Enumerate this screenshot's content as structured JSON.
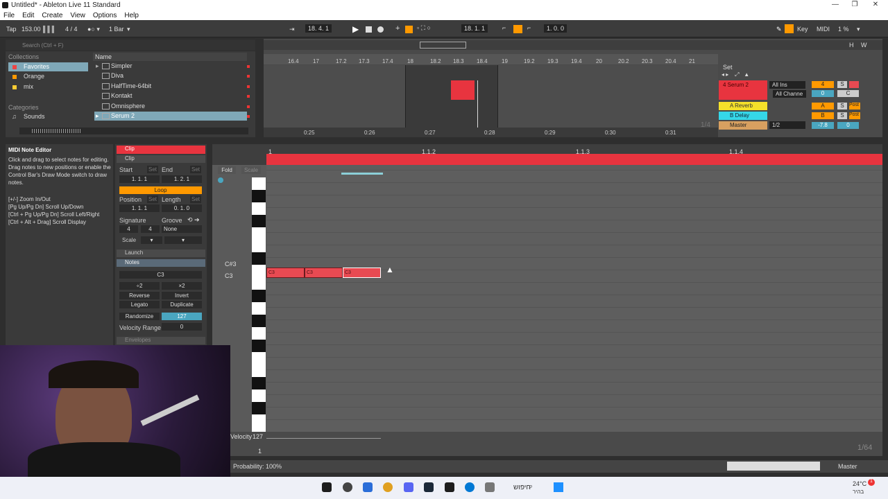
{
  "window": {
    "title": "Untitled* - Ableton Live 11 Standard",
    "buttons": [
      "—",
      "❐",
      "✕"
    ]
  },
  "menu": [
    "File",
    "Edit",
    "Create",
    "View",
    "Options",
    "Help"
  ],
  "transport": {
    "tap": "Tap",
    "tempo": "153.00",
    "signature": "4 / 4",
    "quantize": "1 Bar",
    "position": "18.   4.   1",
    "loop_start": "18.   1.   1",
    "loop_length": "1.   0.   0",
    "key": "Key",
    "midi": "MIDI",
    "cpu": "1 %"
  },
  "browser": {
    "search_placeholder": "Search (Ctrl + F)",
    "collections_header": "Collections",
    "collections": [
      {
        "label": "Favorites",
        "color": "#e44"
      },
      {
        "label": "Orange",
        "color": "#f90"
      },
      {
        "label": "mix",
        "color": "#fc3"
      }
    ],
    "categories_header": "Categories",
    "categories": [
      "Sounds"
    ],
    "name_header": "Name",
    "files": [
      "Simpler",
      "Diva",
      "HalfTime-64bit",
      "Kontakt",
      "Omnisphere",
      "Serum 2"
    ]
  },
  "arrangement": {
    "ruler": [
      "16.4",
      "17",
      "17.2",
      "17.3",
      "17.4",
      "18",
      "18.2",
      "18.3",
      "18.4",
      "19",
      "19.2",
      "19.3",
      "19.4",
      "20",
      "20.2",
      "20.3",
      "20.4",
      "21"
    ],
    "time": [
      "0:25",
      "0:26",
      "0:27",
      "0:28",
      "0:29",
      "0:30",
      "0:31"
    ],
    "set_label": "Set",
    "zoom": "1/4",
    "hw_h": "H",
    "hw_w": "W"
  },
  "mixer": {
    "tracks": [
      {
        "name": "4 Serum 2",
        "color": "#e8343f",
        "input": "All Ins",
        "channel": "All Channe",
        "num": "4",
        "vol": "0",
        "pan": "C"
      },
      {
        "name": "A Reverb",
        "color": "#f5e12a",
        "num": "A",
        "send": "Post"
      },
      {
        "name": "B Delay",
        "color": "#35d7e8",
        "num": "B",
        "send": "Post"
      },
      {
        "name": "Master",
        "color": "#d8a060",
        "split": "1/2",
        "vol": "-7.8",
        "pan": "0"
      }
    ]
  },
  "help": {
    "title": "MIDI Note Editor",
    "body": "Click and drag to select notes for editing. Drag notes to new positions or enable the Control Bar's Draw Mode switch to draw notes.",
    "shortcuts": [
      "[+/-] Zoom In/Out",
      "[Pg Up/Pg Dn] Scroll Up/Down",
      "[Ctrl + Pg Up/Pg Dn] Scroll Left/Right",
      "[Ctrl + Alt + Drag] Scroll Display"
    ]
  },
  "clip": {
    "name": "Clip",
    "section": "Clip",
    "start": "Start",
    "end": "End",
    "set": "Set",
    "start_val": "1.   1.   1",
    "end_val": "1.   2.   1",
    "loop": "Loop",
    "position": "Position",
    "length": "Length",
    "position_val": "1.   1.   1",
    "length_val": "0.   1.   0",
    "signature": "Signature",
    "groove": "Groove",
    "sig_num": "4",
    "sig_den": "4",
    "groove_val": "None",
    "scale": "Scale",
    "launch": "Launch",
    "notes": "Notes",
    "note_val": "C3",
    "half": "÷2",
    "double": "×2",
    "reverse": "Reverse",
    "invert": "Invert",
    "legato": "Legato",
    "duplicate": "Duplicate",
    "randomize": "Randomize",
    "rand_val": "127",
    "vel_range": "Velocity Range",
    "vel_range_val": "0",
    "envelopes": "Envelopes"
  },
  "editor": {
    "fold": "Fold",
    "scale": "Scale",
    "bar_labels": [
      "1",
      "1.1.2",
      "1.1.3",
      "1.1.4"
    ],
    "key_labels": [
      "C#3",
      "C3"
    ],
    "notes": [
      "C3",
      "C3",
      "C3"
    ],
    "velocity": "Velocity",
    "vel_max": "127",
    "vel_min": "1",
    "grid": "1/64"
  },
  "status": {
    "probability": "Probability: 100%",
    "master": "Master"
  },
  "taskbar": {
    "search": "חיפוש",
    "temp": "24°C",
    "sub": "בהיר",
    "badge": "1"
  }
}
